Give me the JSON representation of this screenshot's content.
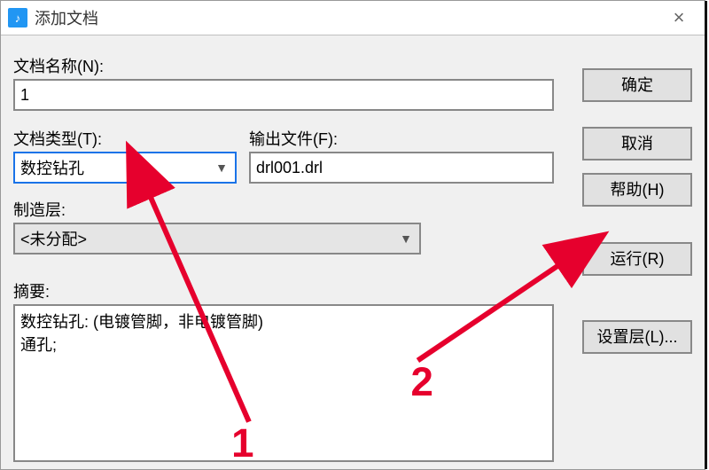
{
  "window": {
    "title": "添加文档",
    "close_glyph": "×",
    "icon_glyph": "♪"
  },
  "labels": {
    "doc_name": "文档名称(N):",
    "doc_type": "文档类型(T):",
    "output_file": "输出文件(F):",
    "mfg_layer": "制造层:",
    "summary": "摘要:"
  },
  "fields": {
    "doc_name_value": "1",
    "doc_type_selected": "数控钻孔",
    "output_file_value": "drl001.drl",
    "mfg_layer_selected": "<未分配>",
    "summary_text": "数控钻孔: (电镀管脚，非电镀管脚)\n通孔;"
  },
  "buttons": {
    "ok": "确定",
    "cancel": "取消",
    "help": "帮助(H)",
    "run": "运行(R)",
    "set_layers": "设置层(L)..."
  },
  "annotations": {
    "one": "1",
    "two": "2"
  }
}
